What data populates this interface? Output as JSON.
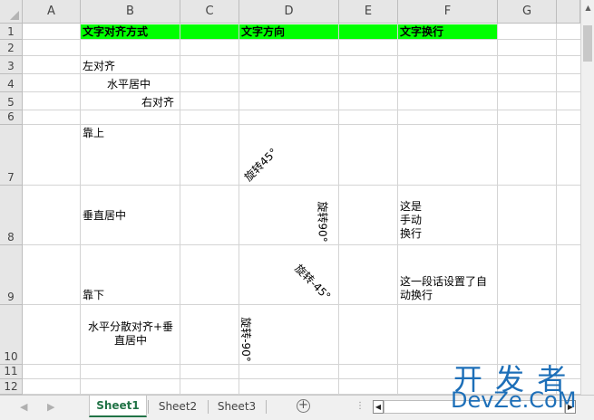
{
  "columns": [
    "A",
    "B",
    "C",
    "D",
    "E",
    "F",
    "G"
  ],
  "rows": [
    "1",
    "2",
    "3",
    "4",
    "5",
    "6",
    "7",
    "8",
    "9",
    "10",
    "11",
    "12"
  ],
  "header_fill_color": "#00ff00",
  "cells": {
    "B1": "文字对齐方式",
    "D1": "文字方向",
    "F1": "文字换行",
    "B3": "左对齐",
    "B4": "水平居中",
    "B5": "右对齐",
    "B7": "靠上",
    "D7": "旋转45°",
    "B8": "垂直居中",
    "D8": "旋转90°",
    "F8": [
      "这是",
      "手动",
      "换行"
    ],
    "B9": "靠下",
    "D9": "旋转-45°",
    "F9": [
      "这一段话设置了自",
      "动换行"
    ],
    "B10": [
      "水平分散对齐+垂",
      "直居中"
    ],
    "D10": "旋转-90°"
  },
  "sheets": [
    {
      "label": "Sheet1",
      "active": true
    },
    {
      "label": "Sheet2",
      "active": false
    },
    {
      "label": "Sheet3",
      "active": false
    }
  ],
  "add_sheet_icon": "plus-circle-icon",
  "watermark": {
    "line1": "开 发 者",
    "line2": "DevZe.CoM"
  }
}
